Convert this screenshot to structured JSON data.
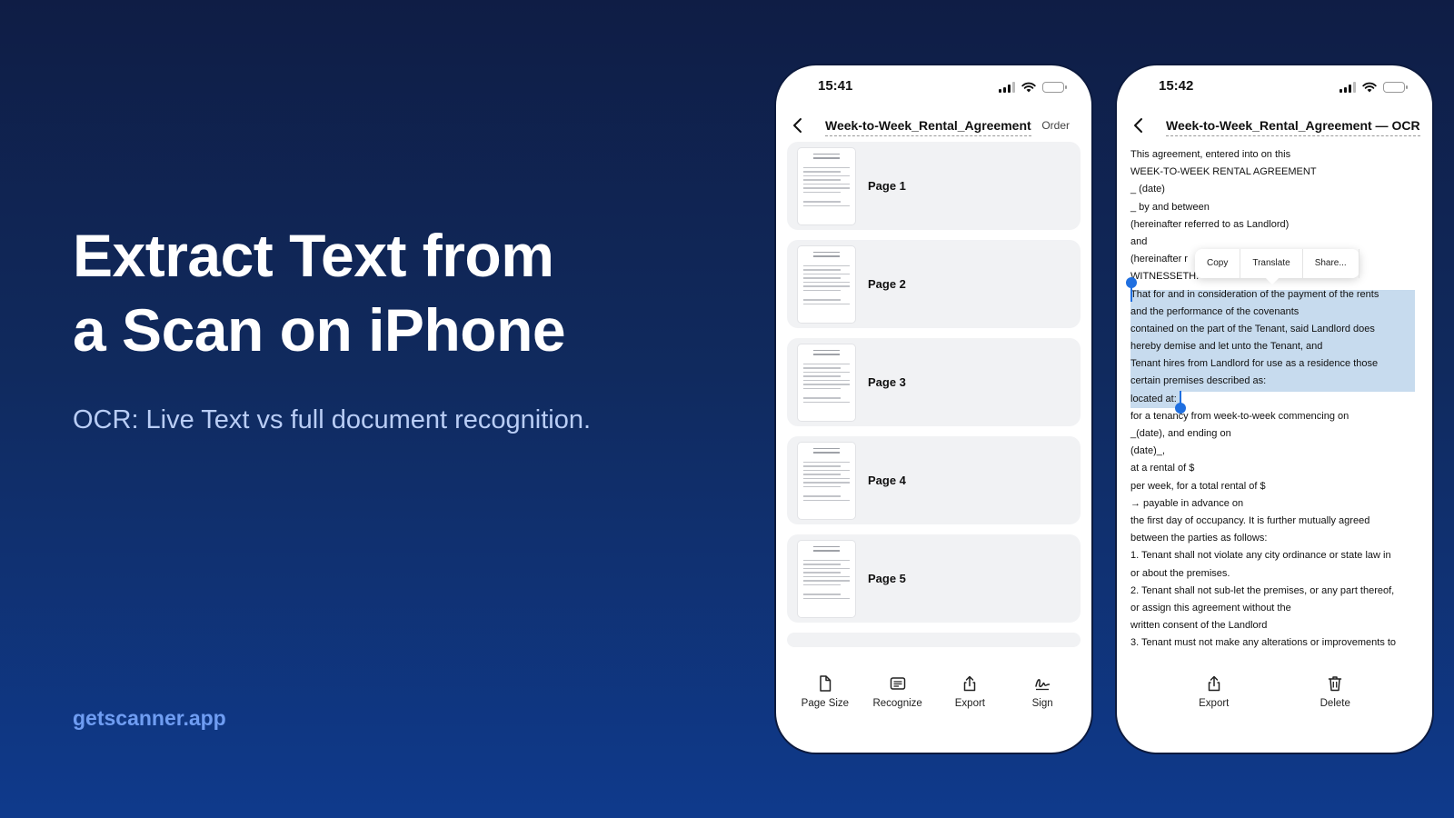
{
  "hero": {
    "title_line1": "Extract Text from",
    "title_line2": "a Scan on iPhone",
    "subtitle": "OCR: Live Text vs full document recognition.",
    "domain": "getscanner.app"
  },
  "colors": {
    "background_top": "#0f1d45",
    "background_bottom": "#0f3a8c",
    "accent": "#6f9df2",
    "selection": "#c7dbee",
    "handle": "#1f6fe0"
  },
  "phone1": {
    "time": "15:41",
    "title": "Week-to-Week_Rental_Agreement",
    "action": "Order",
    "pages": [
      {
        "label": "Page 1"
      },
      {
        "label": "Page 2"
      },
      {
        "label": "Page 3"
      },
      {
        "label": "Page 4"
      },
      {
        "label": "Page 5"
      }
    ],
    "toolbar": [
      {
        "label": "Page Size",
        "icon": "document-icon"
      },
      {
        "label": "Recognize",
        "icon": "text-box-icon"
      },
      {
        "label": "Export",
        "icon": "share-icon"
      },
      {
        "label": "Sign",
        "icon": "signature-icon"
      }
    ]
  },
  "phone2": {
    "time": "15:42",
    "title": "Week-to-Week_Rental_Agreement — OCR",
    "lines": [
      "This agreement, entered into on this",
      "WEEK-TO-WEEK RENTAL AGREEMENT",
      "_ (date)",
      "_ by and between",
      "(hereinafter referred to as Landlord)",
      "and",
      "(hereinafter r",
      "WITNESSETH.",
      "That for and in consideration of the payment of the rents",
      "and the performance of the covenants",
      "contained on the part of the Tenant, said Landlord does",
      "hereby demise and let unto the Tenant, and",
      "Tenant hires from Landlord for use as a residence those",
      "certain premises described as:",
      "located at:",
      "for a tenancy from week-to-week commencing on",
      "_(date), and ending on",
      "(date)_,",
      "at a rental of $",
      "per week, for a total rental of $",
      "→ payable in advance on",
      "the first day of occupancy. It is further mutually agreed",
      "between the parties as follows:",
      "1. Tenant shall not violate any city ordinance or state law in",
      "or about the premises.",
      "2. Tenant shall not sub-let the premises, or any part thereof,",
      "or assign this agreement without the",
      "written consent of the Landlord",
      "3. Tenant must not make any alterations or improvements to"
    ],
    "context_menu": [
      "Copy",
      "Translate",
      "Share..."
    ],
    "toolbar": [
      {
        "label": "Export",
        "icon": "share-icon"
      },
      {
        "label": "Delete",
        "icon": "trash-icon"
      }
    ]
  }
}
